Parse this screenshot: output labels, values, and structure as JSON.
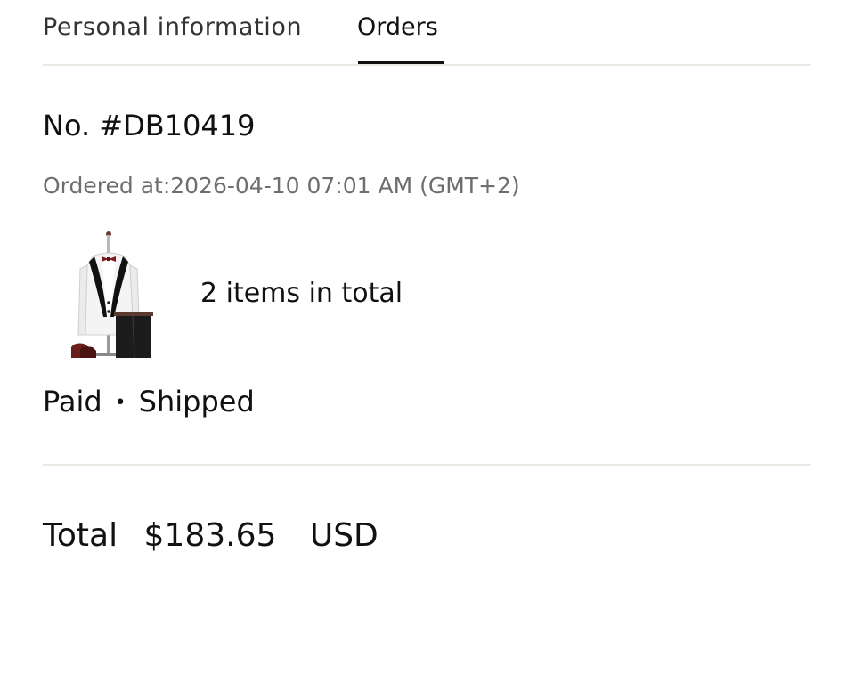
{
  "tabs": [
    {
      "label": "Personal information",
      "active": false
    },
    {
      "label": "Orders",
      "active": true
    }
  ],
  "order": {
    "number": "No. #DB10419",
    "ordered_at": "Ordered at:2026-04-10 07:01 AM (GMT+2)",
    "thumbnail_icon": "tuxedo-suit-image",
    "items_text": "2 items in total",
    "payment_status": "Paid",
    "status_separator": "•",
    "shipping_status": "Shipped",
    "total_label": "Total",
    "total_amount": "$183.65",
    "total_currency": "USD"
  },
  "colors": {
    "text": "#111111",
    "muted_text": "#6e6e6e",
    "divider": "#e9e9e4",
    "active_tab_underline": "#111111"
  }
}
